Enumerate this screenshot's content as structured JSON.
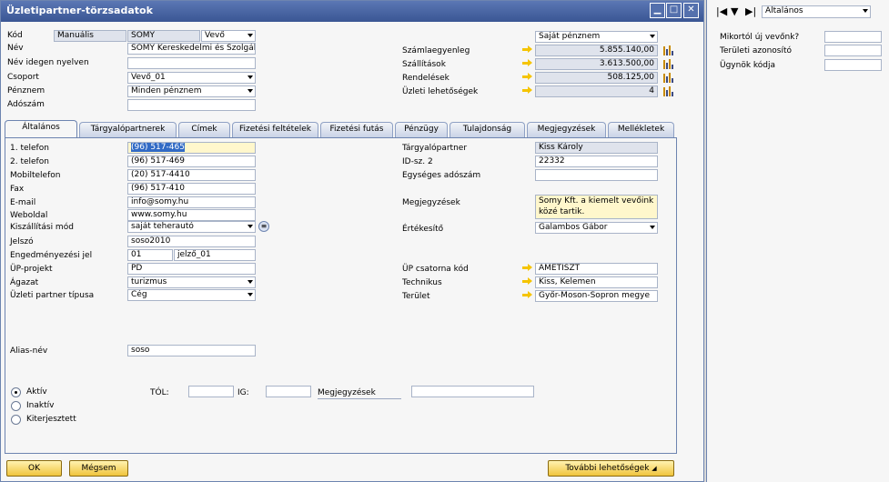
{
  "window": {
    "title": "Üzletipartner-törzsadatok"
  },
  "header": {
    "kod_label": "Kód",
    "kod_series": "Manuális",
    "kod_value": "SOMY",
    "kod_type": "Vevő",
    "nev_label": "Név",
    "nev_value": "SOMY Kereskedelmi és Szolgálta",
    "nev_idegen_label": "Név idegen nyelven",
    "nev_idegen_value": "",
    "csoport_label": "Csoport",
    "csoport_value": "Vevő_01",
    "penznem_label": "Pénznem",
    "penznem_value": "Minden pénznem",
    "adoszam_label": "Adószám",
    "adoszam_value": "",
    "currency_select": "Saját pénznem",
    "szamlaegyenleg_label": "Számlaegyenleg",
    "szamlaegyenleg_value": "5.855.140,00",
    "szallitasok_label": "Szállítások",
    "szallitasok_value": "3.613.500,00",
    "rendelesek_label": "Rendelések",
    "rendelesek_value": "508.125,00",
    "lehetosegek_label": "Üzleti lehetőségek",
    "lehetosegek_value": "4"
  },
  "tabs": [
    "Általános",
    "Tárgyalópartnerek",
    "Címek",
    "Fizetési feltételek",
    "Fizetési futás",
    "Pénzügy",
    "Tulajdonság",
    "Megjegyzések",
    "Mellékletek"
  ],
  "general": {
    "tel1_label": "1. telefon",
    "tel1_value": "(96) 517-465",
    "tel2_label": "2. telefon",
    "tel2_value": "(96) 517-469",
    "mobil_label": "Mobiltelefon",
    "mobil_value": "(20) 517-4410",
    "fax_label": "Fax",
    "fax_value": "(96) 517-410",
    "email_label": "E-mail",
    "email_value": "info@somy.hu",
    "web_label": "Weboldal",
    "web_value": "www.somy.hu",
    "szallitasi_label": "Kiszállítási mód",
    "szallitasi_value": "saját teherautó",
    "jelszo_label": "Jelszó",
    "jelszo_value": "soso2010",
    "engedmeny_label": "Engedményezési jel",
    "engedmeny_value1": "01",
    "engedmeny_value2": "jelző_01",
    "up_projekt_label": "ÜP-projekt",
    "up_projekt_value": "PD",
    "agazat_label": "Ágazat",
    "agazat_value": "turizmus",
    "partner_tipus_label": "Üzleti partner típusa",
    "partner_tipus_value": "Cég",
    "alias_label": "Alias-név",
    "alias_value": "soso",
    "targyalo_label": "Tárgyalópartner",
    "targyalo_value": "Kiss Károly",
    "id2_label": "ID-sz. 2",
    "id2_value": "22332",
    "egyseges_label": "Egységes adószám",
    "egyseges_value": "",
    "megjegyzesek_label": "Megjegyzések",
    "megjegyzesek_value": "Somy Kft. a kiemelt vevőink közé tartik.",
    "ertekesito_label": "Értékesítő",
    "ertekesito_value": "Galambos Gábor",
    "csatorna_label": "ÜP csatorna kód",
    "csatorna_value": "AMETISZT",
    "technikus_label": "Technikus",
    "technikus_value": "Kiss, Kelemen",
    "terulet_label": "Terület",
    "terulet_value": "Győr-Moson-Sopron megye",
    "status_options": [
      "Aktív",
      "Inaktív",
      "Kiterjesztett"
    ],
    "status_selected": "Aktív",
    "tol_label": "TÓL:",
    "ig_label": "IG:",
    "status_megj_label": "Megjegyzések"
  },
  "buttons": {
    "ok": "OK",
    "cancel": "Mégsem",
    "more": "További lehetőségek"
  },
  "sidepanel": {
    "select_value": "Általános",
    "fields": [
      {
        "label": "Mikortól új vevőnk?",
        "value": ""
      },
      {
        "label": "Területi azonosító",
        "value": ""
      },
      {
        "label": "Ügynök kódja",
        "value": ""
      }
    ]
  },
  "colors": {
    "title_bar": "#3a5694",
    "highlight": "#fff7cc",
    "button": "#f0c43c",
    "link_arrow": "#f5c400"
  }
}
